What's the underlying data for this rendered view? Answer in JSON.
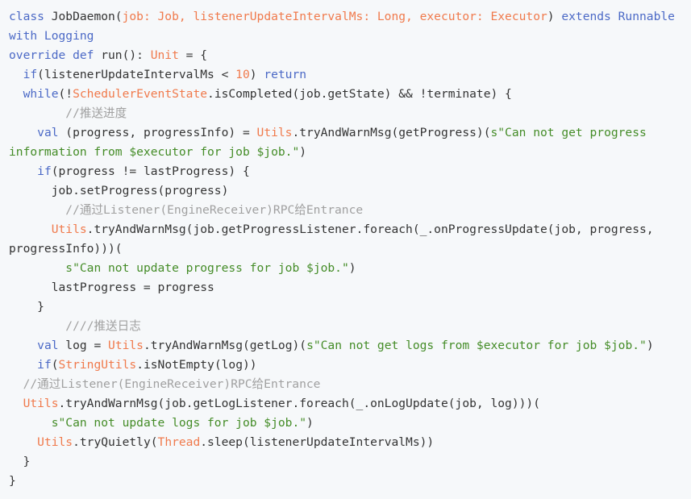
{
  "theme": {
    "background": "#f6f8fa",
    "keyword": "#4b69c6",
    "type": "#f07a4c",
    "number": "#f07a4c",
    "string": "#448c27",
    "comment": "#a0a0a0",
    "plain": "#333333"
  },
  "code": {
    "lines": [
      [
        {
          "t": "kw",
          "v": "class"
        },
        {
          "t": "pl",
          "v": " JobDaemon("
        },
        {
          "t": "ty",
          "v": "job: Job, listenerUpdateIntervalMs: Long, executor: Executor"
        },
        {
          "t": "pl",
          "v": ") "
        },
        {
          "t": "kw",
          "v": "extends Runnable"
        }
      ],
      [
        {
          "t": "kw",
          "v": "with Logging"
        }
      ],
      [
        {
          "t": "kw",
          "v": "override def"
        },
        {
          "t": "pl",
          "v": " run(): "
        },
        {
          "t": "ty",
          "v": "Unit"
        },
        {
          "t": "pl",
          "v": " = {"
        }
      ],
      [
        {
          "t": "pl",
          "v": "  "
        },
        {
          "t": "kw",
          "v": "if"
        },
        {
          "t": "pl",
          "v": "(listenerUpdateIntervalMs < "
        },
        {
          "t": "num",
          "v": "10"
        },
        {
          "t": "pl",
          "v": ") "
        },
        {
          "t": "kw",
          "v": "return"
        }
      ],
      [
        {
          "t": "pl",
          "v": "  "
        },
        {
          "t": "kw",
          "v": "while"
        },
        {
          "t": "pl",
          "v": "(!"
        },
        {
          "t": "ty",
          "v": "SchedulerEventState"
        },
        {
          "t": "pl",
          "v": ".isCompleted(job.getState) && !terminate) {"
        }
      ],
      [
        {
          "t": "cmt",
          "v": "        //推送进度"
        }
      ],
      [
        {
          "t": "pl",
          "v": "    "
        },
        {
          "t": "kw",
          "v": "val"
        },
        {
          "t": "pl",
          "v": " (progress, progressInfo) = "
        },
        {
          "t": "ty",
          "v": "Utils"
        },
        {
          "t": "pl",
          "v": ".tryAndWarnMsg(getProgress)("
        },
        {
          "t": "str",
          "v": "s\"Can not get progress"
        }
      ],
      [
        {
          "t": "str",
          "v": "information from $executor for job $job.\""
        },
        {
          "t": "pl",
          "v": ")"
        }
      ],
      [
        {
          "t": "pl",
          "v": "    "
        },
        {
          "t": "kw",
          "v": "if"
        },
        {
          "t": "pl",
          "v": "(progress != lastProgress) {"
        }
      ],
      [
        {
          "t": "pl",
          "v": "      job.setProgress(progress)"
        }
      ],
      [
        {
          "t": "cmt",
          "v": "        //通过Listener(EngineReceiver)RPC给Entrance"
        }
      ],
      [
        {
          "t": "pl",
          "v": "      "
        },
        {
          "t": "ty",
          "v": "Utils"
        },
        {
          "t": "pl",
          "v": ".tryAndWarnMsg(job.getProgressListener.foreach(_.onProgressUpdate(job, progress,"
        }
      ],
      [
        {
          "t": "pl",
          "v": "progressInfo)))("
        }
      ],
      [
        {
          "t": "pl",
          "v": "        "
        },
        {
          "t": "str",
          "v": "s\"Can not update progress for job $job.\""
        },
        {
          "t": "pl",
          "v": ")"
        }
      ],
      [
        {
          "t": "pl",
          "v": "      lastProgress = progress"
        }
      ],
      [
        {
          "t": "pl",
          "v": "    }"
        }
      ],
      [
        {
          "t": "cmt",
          "v": "        ////推送日志"
        }
      ],
      [
        {
          "t": "pl",
          "v": "    "
        },
        {
          "t": "kw",
          "v": "val"
        },
        {
          "t": "pl",
          "v": " log = "
        },
        {
          "t": "ty",
          "v": "Utils"
        },
        {
          "t": "pl",
          "v": ".tryAndWarnMsg(getLog)("
        },
        {
          "t": "str",
          "v": "s\"Can not get logs from $executor for job $job.\""
        },
        {
          "t": "pl",
          "v": ")"
        }
      ],
      [
        {
          "t": "pl",
          "v": "    "
        },
        {
          "t": "kw",
          "v": "if"
        },
        {
          "t": "pl",
          "v": "("
        },
        {
          "t": "ty",
          "v": "StringUtils"
        },
        {
          "t": "pl",
          "v": ".isNotEmpty(log))"
        }
      ],
      [
        {
          "t": "cmt",
          "v": "  //通过Listener(EngineReceiver)RPC给Entrance"
        }
      ],
      [
        {
          "t": "pl",
          "v": "  "
        },
        {
          "t": "ty",
          "v": "Utils"
        },
        {
          "t": "pl",
          "v": ".tryAndWarnMsg(job.getLogListener.foreach(_.onLogUpdate(job, log)))("
        }
      ],
      [
        {
          "t": "pl",
          "v": "      "
        },
        {
          "t": "str",
          "v": "s\"Can not update logs for job $job.\""
        },
        {
          "t": "pl",
          "v": ")"
        }
      ],
      [
        {
          "t": "pl",
          "v": "    "
        },
        {
          "t": "ty",
          "v": "Utils"
        },
        {
          "t": "pl",
          "v": ".tryQuietly("
        },
        {
          "t": "ty",
          "v": "Thread"
        },
        {
          "t": "pl",
          "v": ".sleep(listenerUpdateIntervalMs))"
        }
      ],
      [
        {
          "t": "pl",
          "v": "  }"
        }
      ],
      [
        {
          "t": "pl",
          "v": "}"
        }
      ]
    ]
  }
}
